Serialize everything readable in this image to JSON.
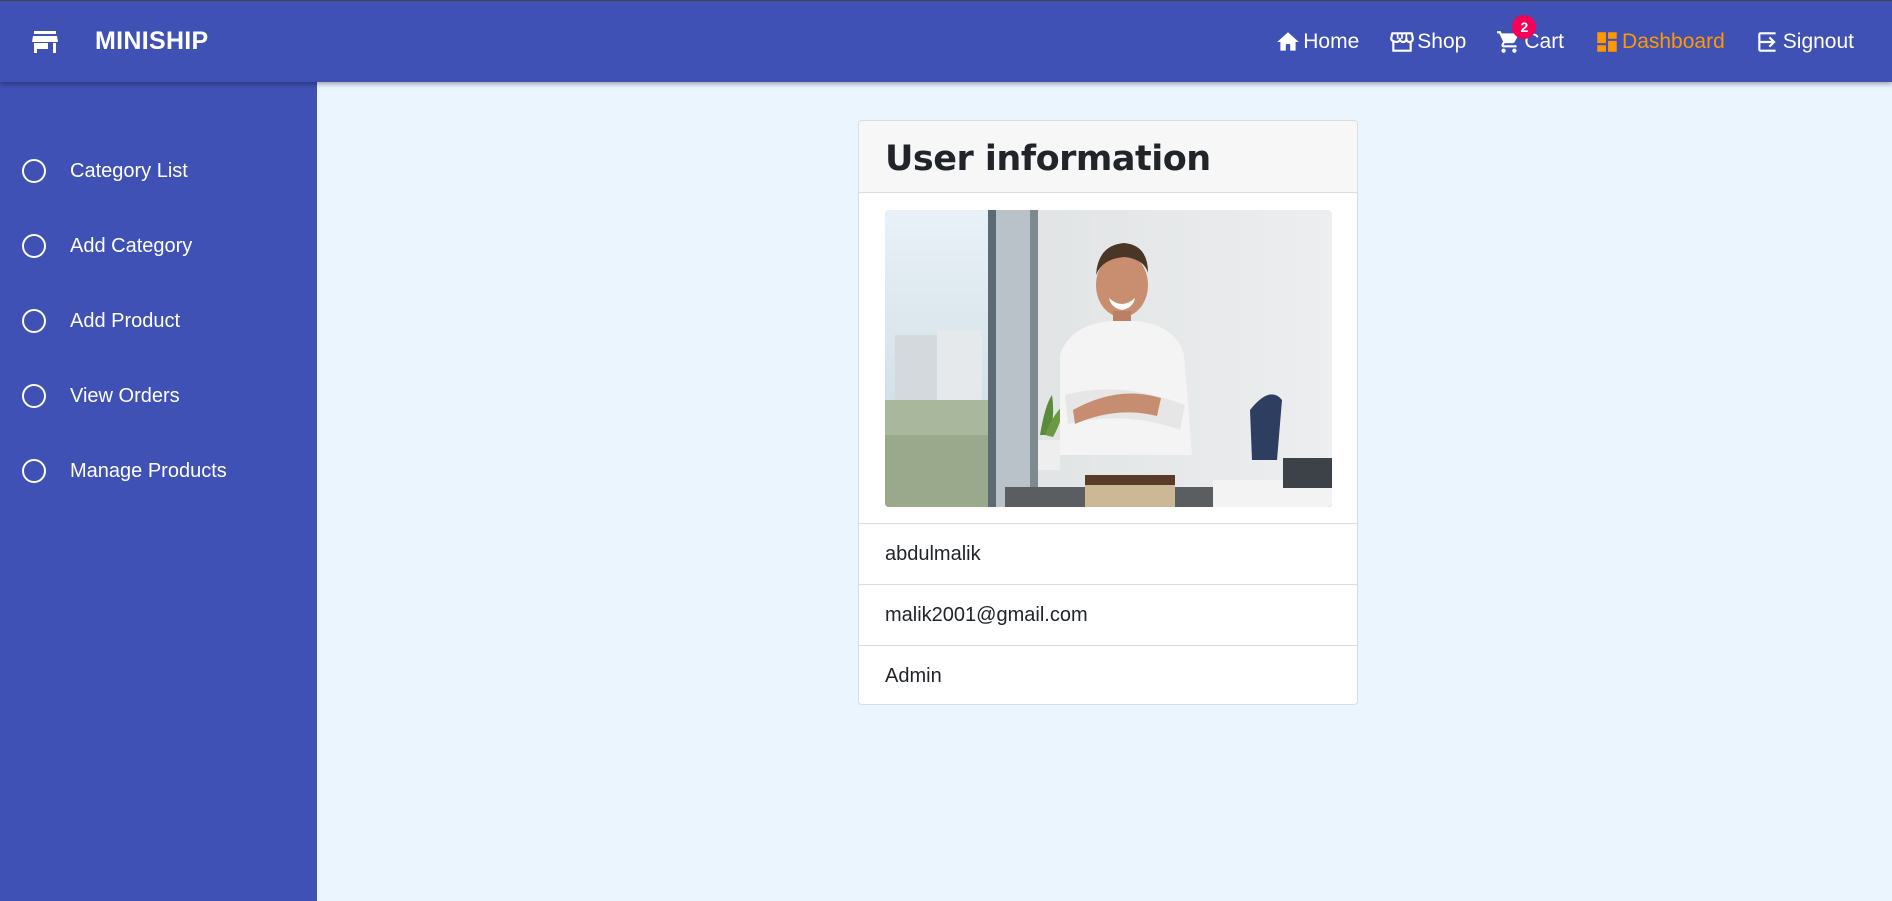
{
  "brand": {
    "name": "MINISHIP",
    "icon": "store-icon"
  },
  "nav": {
    "home": "Home",
    "shop": "Shop",
    "cart": "Cart",
    "cart_count": "2",
    "dashboard": "Dashboard",
    "signout": "Signout",
    "active_color": "#ff9800"
  },
  "sidebar": {
    "items": [
      {
        "label": "Category List"
      },
      {
        "label": "Add Category"
      },
      {
        "label": "Add Product"
      },
      {
        "label": "View Orders"
      },
      {
        "label": "Manage Products"
      }
    ]
  },
  "user_card": {
    "title": "User information",
    "photo": "profile-photo",
    "username": "abdulmalik",
    "email": "malik2001@gmail.com",
    "role": "Admin"
  },
  "colors": {
    "primary": "#3f51b5",
    "background": "#ebf5fe",
    "badge": "#f50057"
  }
}
